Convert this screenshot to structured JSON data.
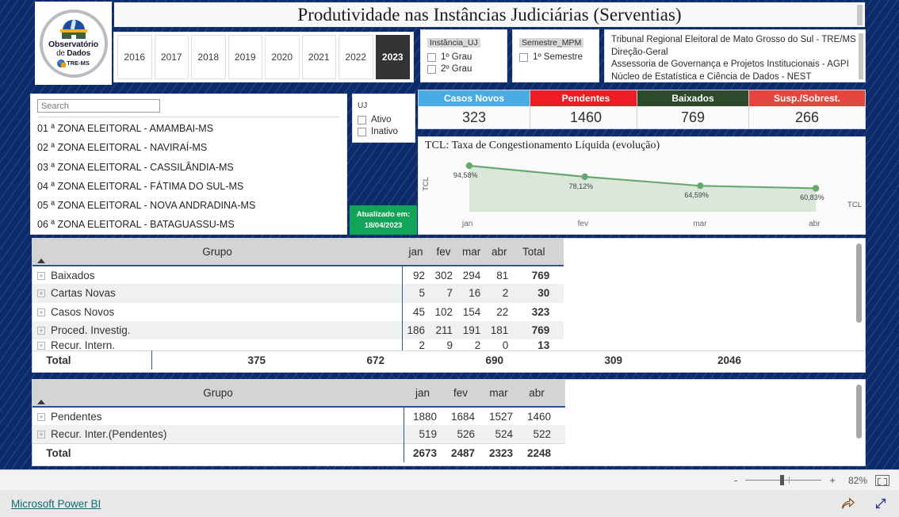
{
  "brand": {
    "logo_line1": "Observatório",
    "logo_line2_a": "de ",
    "logo_line2_b": "Dados",
    "logo_badge": "TRE-MS"
  },
  "header": {
    "title": "Produtividade nas Instâncias Judiciárias (Serventias)"
  },
  "year_slicer": {
    "years": [
      "2016",
      "2017",
      "2018",
      "2019",
      "2020",
      "2021",
      "2022",
      "2023"
    ],
    "selected": "2023"
  },
  "slicer_instancia": {
    "title": "Instância_UJ",
    "options": [
      "1º Grau",
      "2º Grau"
    ]
  },
  "slicer_semestre": {
    "title": "Semestre_MPM",
    "options": [
      "1º Semestre"
    ]
  },
  "slicer_uj": {
    "title": "UJ",
    "options": [
      "Ativo",
      "Inativo"
    ]
  },
  "org": {
    "lines": [
      "Tribunal Regional Eleitoral de Mato Grosso do Sul - TRE/MS",
      "Direção-Geral",
      "Assessoria de Governança e Projetos Institucionais - AGPI",
      "Núcleo de Estatística e Ciência de Dados - NEST"
    ]
  },
  "search": {
    "placeholder": "Search",
    "value": ""
  },
  "zone_list": [
    "01 ª ZONA ELEITORAL - AMAMBAI-MS",
    "02 ª ZONA ELEITORAL - NAVIRAÍ-MS",
    "03 ª ZONA ELEITORAL - CASSILÂNDIA-MS",
    "04 ª ZONA ELEITORAL - FÁTIMA DO SUL-MS",
    "05 ª ZONA ELEITORAL - NOVA ANDRADINA-MS",
    "06 ª ZONA ELEITORAL - BATAGUASSU-MS"
  ],
  "updated": {
    "label": "Atualizado em:",
    "date": "18/04/2023"
  },
  "kpis": [
    {
      "label": "Casos Novos",
      "value": "323",
      "color": "#49ade3"
    },
    {
      "label": "Pendentes",
      "value": "1460",
      "color": "#ee1c25"
    },
    {
      "label": "Baixados",
      "value": "769",
      "color": "#2d4a2b"
    },
    {
      "label": "Susp./Sobrest.",
      "value": "266",
      "color": "#e8443f"
    }
  ],
  "chart_data": {
    "type": "line",
    "title": "TCL: Taxa de Congestionamento Líquida (evolução)",
    "categories": [
      "jan",
      "fev",
      "mar",
      "abr"
    ],
    "values": [
      94.58,
      78.12,
      64.59,
      60.83
    ],
    "labels": [
      "94,58%",
      "78,12%",
      "64,59%",
      "60,83%"
    ],
    "series_name": "TCL",
    "ylabel": "TCL",
    "xlabel": "",
    "legend": "TCL",
    "legend_position": "right",
    "ylim": [
      0,
      100
    ],
    "grid": false,
    "line_color": "#6aa870",
    "fill_color": "#cfe2d0"
  },
  "table1": {
    "group_header": "Grupo",
    "month_headers": [
      "jan",
      "fev",
      "mar",
      "abr"
    ],
    "total_header": "Total",
    "rows": [
      {
        "group": "Baixados",
        "values": [
          "92",
          "302",
          "294",
          "81"
        ],
        "total": "769"
      },
      {
        "group": "Cartas Novas",
        "values": [
          "5",
          "7",
          "16",
          "2"
        ],
        "total": "30"
      },
      {
        "group": "Casos Novos",
        "values": [
          "45",
          "102",
          "154",
          "22"
        ],
        "total": "323"
      },
      {
        "group": "Proced. Investig.",
        "values": [
          "186",
          "211",
          "191",
          "181"
        ],
        "total": "769"
      },
      {
        "group": "Recur. Intern.",
        "values": [
          "2",
          "9",
          "2",
          "0"
        ],
        "total": "13"
      }
    ],
    "total_row": {
      "label": "Total",
      "values": [
        "375",
        "672",
        "690",
        "309"
      ],
      "total": "2046"
    }
  },
  "table2": {
    "group_header": "Grupo",
    "month_headers": [
      "jan",
      "fev",
      "mar",
      "abr"
    ],
    "rows": [
      {
        "group": "Pendentes",
        "values": [
          "1880",
          "1684",
          "1527",
          "1460"
        ]
      },
      {
        "group": "Recur. Inter.(Pendentes)",
        "values": [
          "519",
          "526",
          "524",
          "522"
        ]
      }
    ],
    "total_row": {
      "label": "Total",
      "values": [
        "2673",
        "2487",
        "2323",
        "2248"
      ]
    }
  },
  "zoombar": {
    "minus": "-",
    "plus": "+",
    "percent": "82%"
  },
  "footer": {
    "link": "Microsoft Power BI"
  }
}
